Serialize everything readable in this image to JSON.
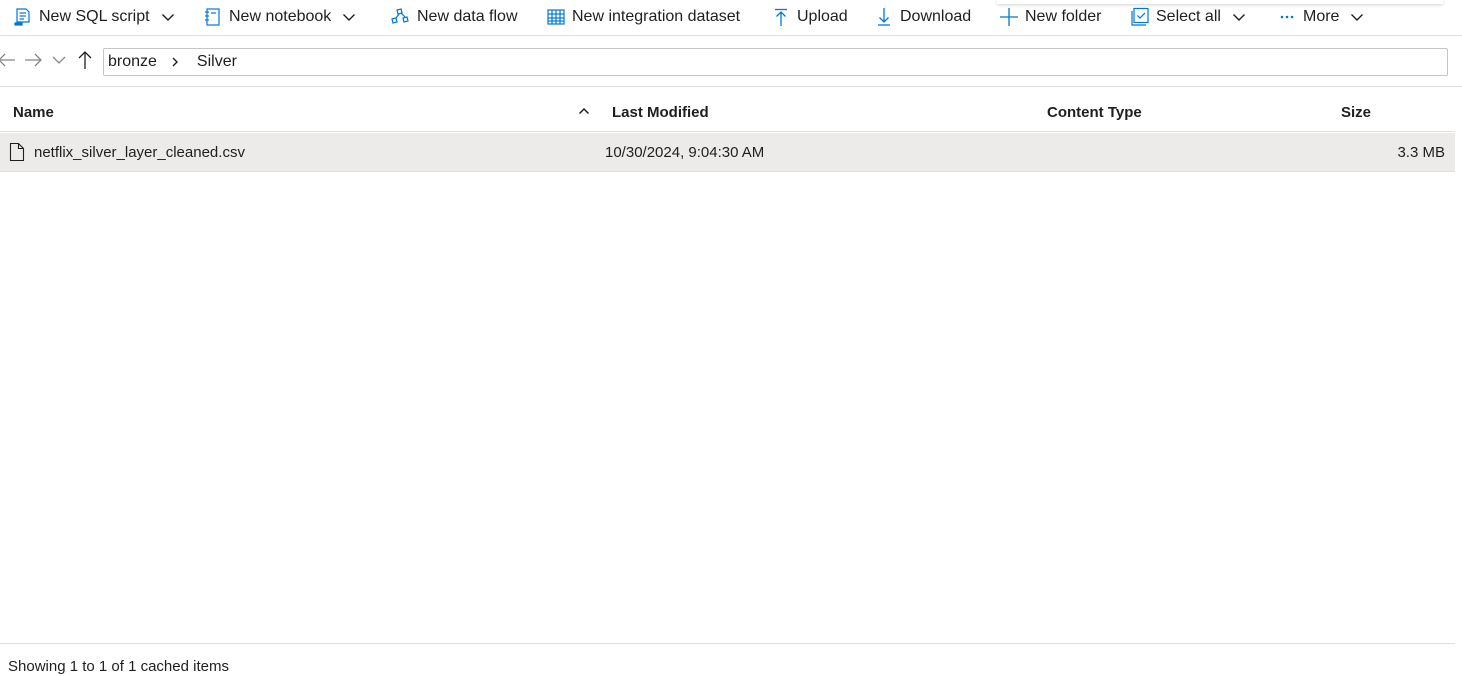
{
  "colors": {
    "accent": "#0078d4",
    "selected_row": "#edebe9",
    "border": "#e1dfdd"
  },
  "toolbar": {
    "new_sql_script": "New SQL script",
    "new_notebook": "New notebook",
    "new_data_flow": "New data flow",
    "new_integration_dataset": "New integration dataset",
    "upload": "Upload",
    "download": "Download",
    "new_folder": "New folder",
    "select_all": "Select all",
    "more": "More"
  },
  "breadcrumb": {
    "items": [
      "bronze",
      "Silver"
    ]
  },
  "table": {
    "columns": [
      "Name",
      "Last Modified",
      "Content Type",
      "Size"
    ],
    "sort_column": "Name",
    "sort_direction": "ascending",
    "rows": [
      {
        "name": "netflix_silver_layer_cleaned.csv",
        "last_modified": "10/30/2024, 9:04:30 AM",
        "content_type": "",
        "size": "3.3 MB",
        "icon": "file-icon",
        "selected": true
      }
    ]
  },
  "footer": {
    "status": "Showing 1 to 1 of 1 cached items"
  }
}
